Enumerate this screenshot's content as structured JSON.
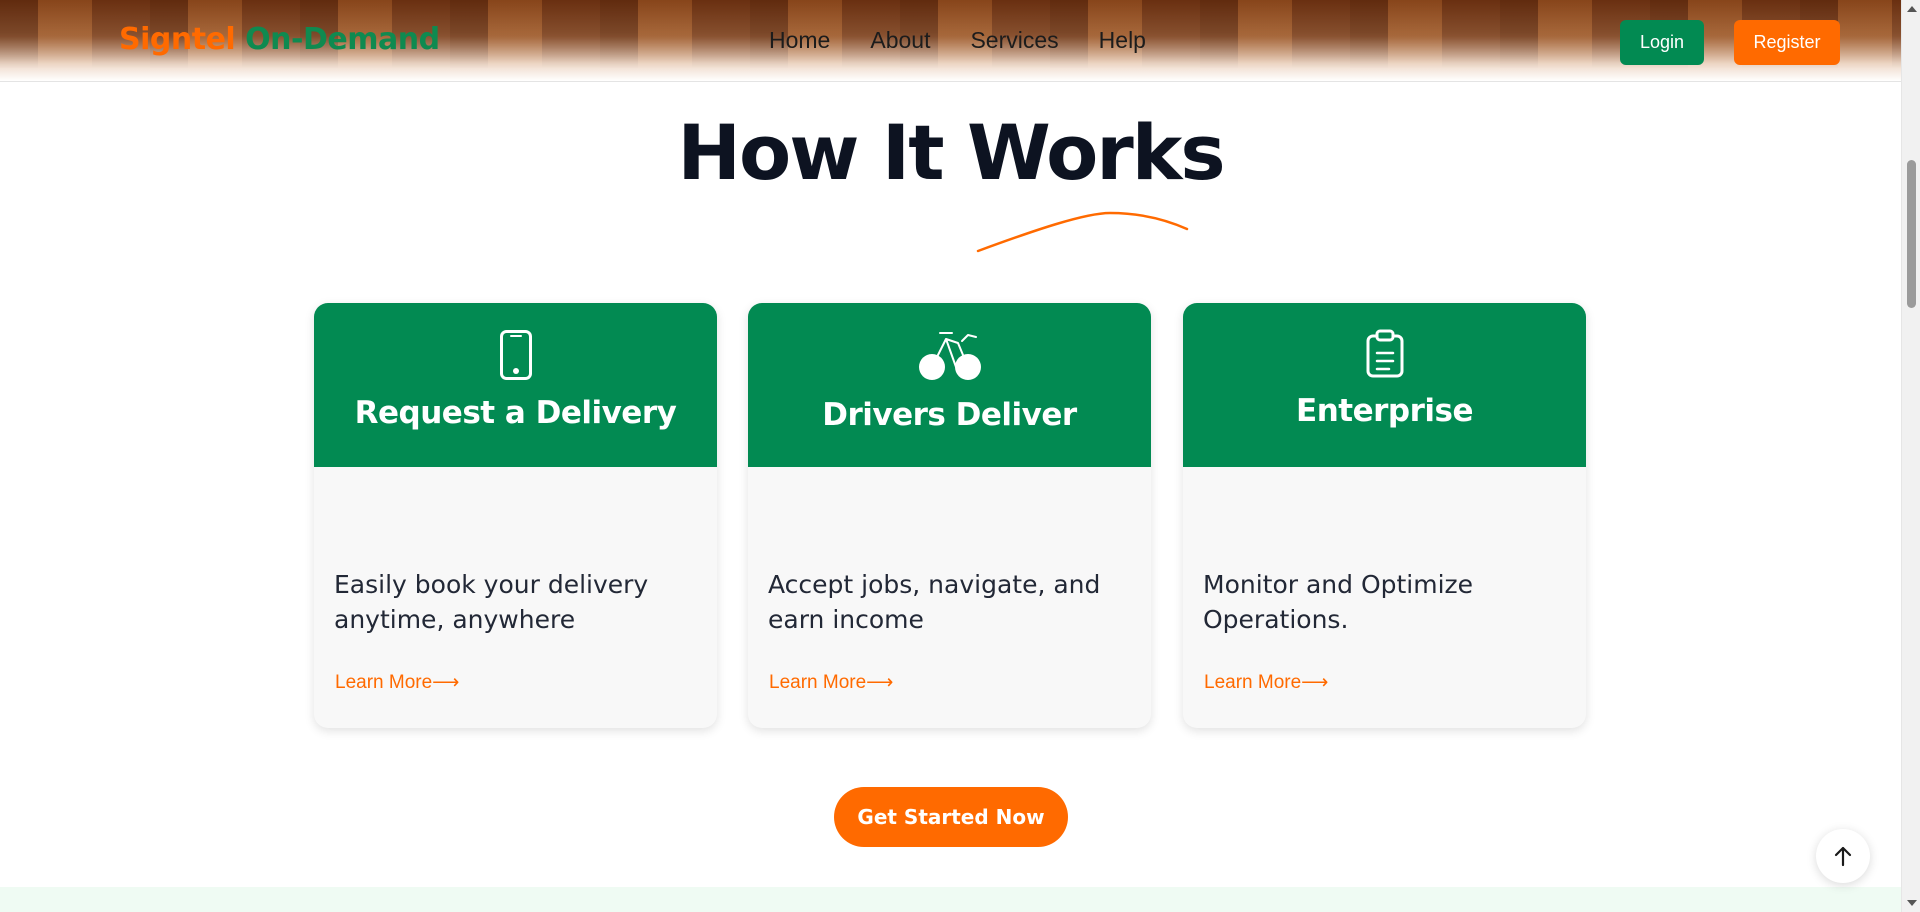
{
  "header": {
    "logo_part1": "Signtel",
    "logo_part2": "On-Demand",
    "nav": [
      "Home",
      "About",
      "Services",
      "Help"
    ],
    "login_label": "Login",
    "register_label": "Register"
  },
  "section": {
    "title": "How It Works"
  },
  "cards": [
    {
      "icon": "phone-icon",
      "title": "Request a Delivery",
      "text": "Easily book your delivery anytime, anywhere",
      "link": "Learn More⟶"
    },
    {
      "icon": "bicycle-icon",
      "title": "Drivers Deliver",
      "text": "Accept jobs, navigate, and earn income",
      "link": "Learn More⟶"
    },
    {
      "icon": "clipboard-icon",
      "title": "Enterprise",
      "text": "Monitor and Optimize Operations.",
      "link": "Learn More⟶"
    }
  ],
  "cta_label": "Get Started Now",
  "back_to_top_icon": "arrow-up-icon",
  "colors": {
    "brand_orange": "#ff6a00",
    "brand_green": "#028a52",
    "card_bg": "#f8f8f8",
    "title_dark": "#0d1321"
  }
}
